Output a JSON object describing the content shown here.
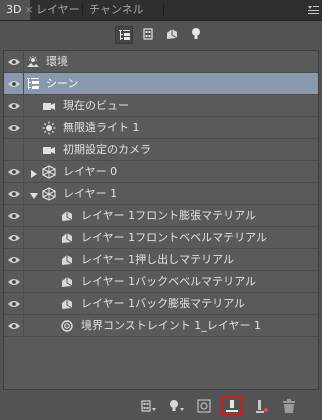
{
  "tabs": [
    {
      "label": "3D",
      "active": true,
      "close": "×"
    },
    {
      "label": "レイヤー",
      "active": false
    },
    {
      "label": "チャンネル",
      "active": false
    }
  ],
  "filters": [
    {
      "icon": "whole-scene-icon",
      "selected": true
    },
    {
      "icon": "meshes-icon",
      "selected": false
    },
    {
      "icon": "materials-icon",
      "selected": false
    },
    {
      "icon": "lights-icon",
      "selected": false
    }
  ],
  "rows": [
    {
      "label": "環境",
      "icon": "environment-icon",
      "visible": true,
      "selected": false
    },
    {
      "label": "シーン",
      "icon": "scene-icon",
      "visible": true,
      "selected": true
    },
    {
      "label": "現在のビュー",
      "icon": "camera-icon",
      "visible": true,
      "selected": false
    },
    {
      "label": "無限遠ライト 1",
      "icon": "light-icon",
      "visible": true,
      "selected": false
    },
    {
      "label": "初期設定のカメラ",
      "icon": "camera-icon",
      "visible": false,
      "selected": false
    },
    {
      "label": "レイヤー 0",
      "icon": "mesh-icon",
      "visible": true,
      "selected": false,
      "expanded": false
    },
    {
      "label": "レイヤー 1",
      "icon": "mesh-icon",
      "visible": true,
      "selected": false,
      "expanded": true
    },
    {
      "label": "レイヤー 1フロント膨張マテリアル",
      "icon": "material-icon",
      "visible": true,
      "selected": false
    },
    {
      "label": "レイヤー 1フロントベベルマテリアル",
      "icon": "material-icon",
      "visible": true,
      "selected": false
    },
    {
      "label": "レイヤー 1押し出しマテリアル",
      "icon": "material-icon",
      "visible": true,
      "selected": false
    },
    {
      "label": "レイヤー 1バックベベルマテリアル",
      "icon": "material-icon",
      "visible": true,
      "selected": false
    },
    {
      "label": "レイヤー 1バック膨張マテリアル",
      "icon": "material-icon",
      "visible": true,
      "selected": false
    },
    {
      "label": "境界コンストレイント 1_レイヤー 1",
      "icon": "constraint-icon",
      "visible": true,
      "selected": false
    }
  ],
  "bottom_buttons": [
    {
      "icon": "add-mesh-dropdown-icon",
      "highlighted": false
    },
    {
      "icon": "add-light-dropdown-icon",
      "highlighted": false
    },
    {
      "icon": "add-constraint-icon",
      "highlighted": false
    },
    {
      "icon": "drop-to-ground-icon",
      "highlighted": true
    },
    {
      "icon": "add-light-icon",
      "highlighted": false
    },
    {
      "icon": "delete-icon",
      "highlighted": false
    }
  ],
  "colors": {
    "panel_bg": "#535353",
    "list_bg": "#5a5a5a",
    "selected_row": "#8a98ad",
    "highlight_border": "#d81818"
  }
}
